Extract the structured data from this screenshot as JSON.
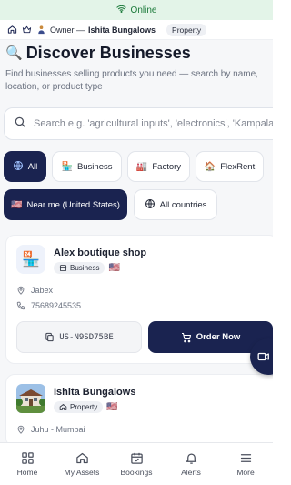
{
  "status": {
    "online_label": "Online"
  },
  "context": {
    "role": "Owner —",
    "account_name": "Ishita Bungalows",
    "account_type": "Property"
  },
  "header": {
    "title": "Discover Businesses",
    "subtitle_line1": "Find businesses selling products you need — search by name,",
    "subtitle_line2": "location, or product type"
  },
  "search": {
    "placeholder": "Search e.g. 'agricultural inputs', 'electronics', 'Kampala'"
  },
  "filters": {
    "type_chips": [
      {
        "label": "All",
        "active": true,
        "icon": "globe-icon"
      },
      {
        "label": "Business",
        "active": false,
        "icon": "store-icon"
      },
      {
        "label": "Factory",
        "active": false,
        "icon": "factory-icon"
      },
      {
        "label": "FlexRent",
        "active": false,
        "icon": "house-icon"
      }
    ],
    "location_chips": [
      {
        "label": "Near me (United States)",
        "active": true,
        "icon": "us-flag"
      },
      {
        "label": "All countries",
        "active": false,
        "icon": "globe-icon"
      }
    ]
  },
  "businesses": [
    {
      "name": "Alex boutique shop",
      "type": "Business",
      "country_flag": "🇺🇸",
      "location": "Jabex",
      "phone": "75689245535",
      "code": "US-N9SD75BE",
      "action_label": "Order Now"
    },
    {
      "name": "Ishita Bungalows",
      "type": "Property",
      "country_flag": "🇺🇸",
      "location": "Juhu - Mumbai"
    }
  ],
  "bottom_nav": [
    {
      "label": "Home",
      "icon": "grid-icon"
    },
    {
      "label": "My Assets",
      "icon": "house-icon"
    },
    {
      "label": "Bookings",
      "icon": "calendar-icon"
    },
    {
      "label": "Alerts",
      "icon": "bell-icon"
    },
    {
      "label": "More",
      "icon": "menu-icon"
    }
  ],
  "colors": {
    "primary": "#1a2350",
    "online_bg": "#e3f4e8",
    "online_text": "#1b7a3a",
    "muted_text": "#6b7280"
  }
}
